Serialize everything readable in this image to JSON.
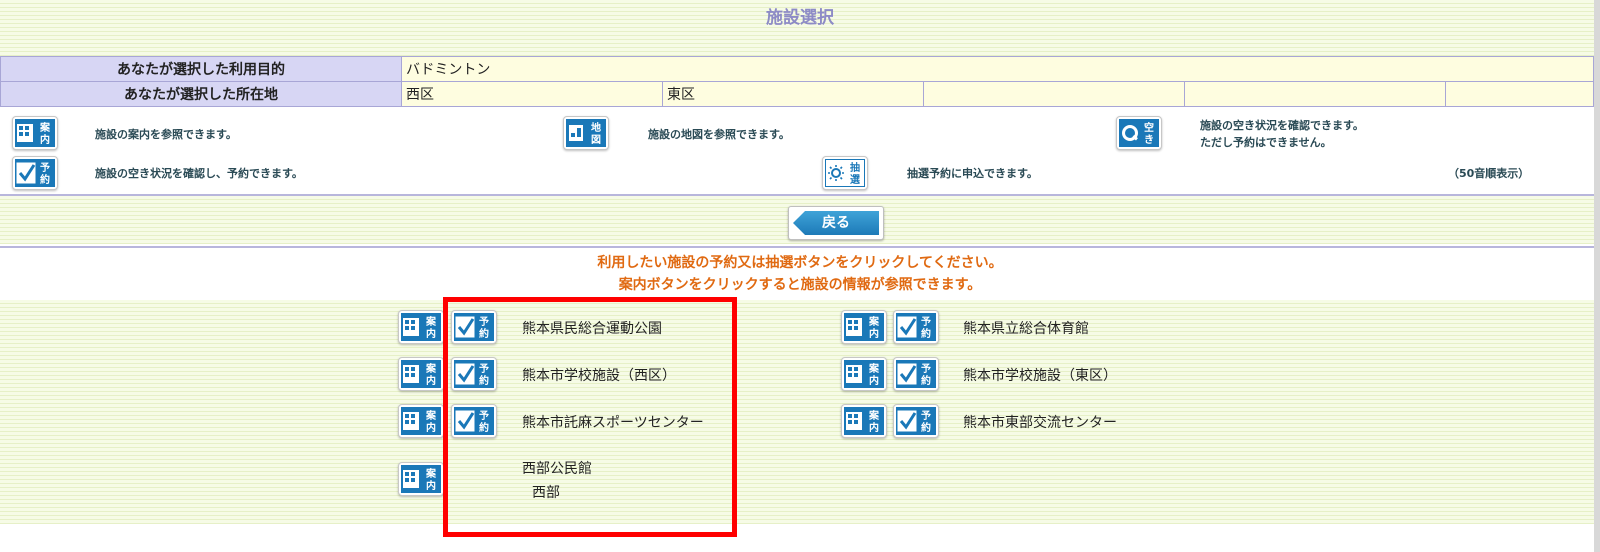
{
  "page_title": "施設選択",
  "conditions": {
    "purpose_label": "あなたが選択した利用目的",
    "purpose_value": "バドミントン",
    "location_label": "あなたが選択した所在地",
    "locations": [
      "西区",
      "東区",
      "",
      "",
      ""
    ]
  },
  "legend": {
    "guide_text": "施設の案内を参照できます。",
    "map_text": "施設の地図を参照できます。",
    "availability_text_1": "施設の空き状況を確認できます。",
    "availability_text_2": "ただし予約はできません。",
    "reserve_text": "施設の空き状況を確認し、予約できます。",
    "lottery_text": "抽選予約に申込できます。",
    "sort_note": "（50音順表示）"
  },
  "icons": {
    "guide": {
      "chars": [
        "案",
        "内"
      ],
      "name": "guide-icon"
    },
    "map": {
      "chars": [
        "地",
        "図"
      ],
      "name": "map-icon"
    },
    "availability": {
      "chars": [
        "空",
        "き"
      ],
      "name": "availability-icon"
    },
    "reserve": {
      "chars": [
        "予",
        "約"
      ],
      "name": "reserve-icon"
    },
    "lottery": {
      "chars": [
        "抽",
        "選"
      ],
      "name": "lottery-icon"
    }
  },
  "back_button": {
    "label": "戻る"
  },
  "messages": {
    "line1": "利用したい施設の予約又は抽選ボタンをクリックしてください。",
    "line2": "案内ボタンをクリックすると施設の情報が参照できます。"
  },
  "facilities": {
    "left": [
      {
        "name": "熊本県民総合運動公園"
      },
      {
        "name": "熊本市学校施設（西区）"
      },
      {
        "name": "熊本市託麻スポーツセンター"
      },
      {
        "name": "西部公民館",
        "sub": "西部"
      }
    ],
    "right": [
      {
        "name": "熊本県立総合体育館"
      },
      {
        "name": "熊本市学校施設（東区）"
      },
      {
        "name": "熊本市東部交流センター"
      }
    ]
  },
  "colors": {
    "title": "#8d8bc6",
    "message": "#e06a12",
    "label_bg": "#d7d6f4",
    "value_bg": "#fefde0",
    "highlight": "#ff0000"
  }
}
